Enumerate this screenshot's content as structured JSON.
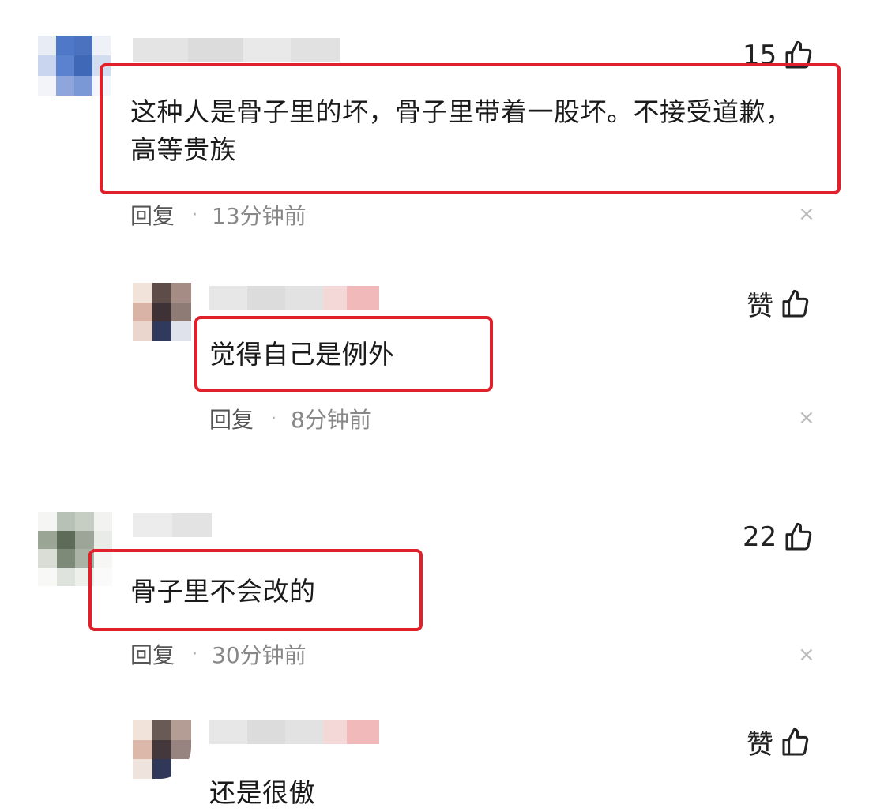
{
  "comments": [
    {
      "text_line1": "这种人是骨子里的坏，骨子里带着一股坏。不接受道歉，",
      "text_line2": "高等贵族",
      "reply_label": "回复",
      "time": "13分钟前",
      "likes": "15"
    },
    {
      "text": "觉得自己是例外",
      "reply_label": "回复",
      "time": "8分钟前",
      "likes": "赞"
    },
    {
      "text": "骨子里不会改的",
      "reply_label": "回复",
      "time": "30分钟前",
      "likes": "22"
    },
    {
      "text": "还是很傲",
      "likes": "赞"
    }
  ],
  "meta": {
    "dot": "·",
    "close_glyph": "×"
  },
  "colors": {
    "highlight_box": "#e0202a",
    "meta_time": "#888888"
  },
  "icons": {
    "like": "thumbs-up-icon",
    "close": "close-icon"
  }
}
